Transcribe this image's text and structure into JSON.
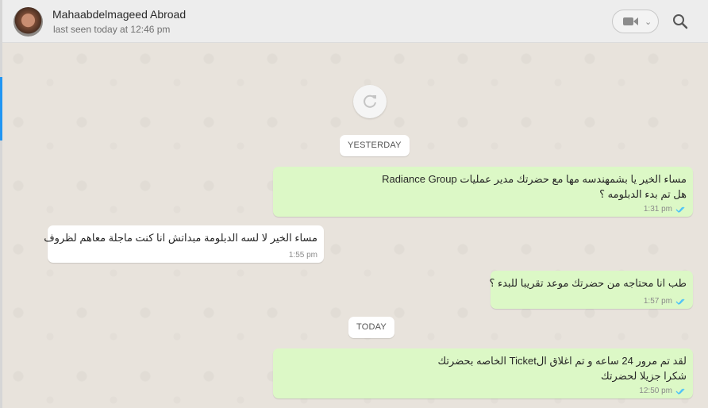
{
  "contact": {
    "name": "Mahaabdelmageed Abroad",
    "status": "last seen today at 12:46 pm"
  },
  "icons": {
    "video": "video-camera-icon",
    "dropdown": "chevron-down-icon",
    "search": "search-icon",
    "reload": "refresh-icon",
    "read": "double-check-icon"
  },
  "colors": {
    "outgoing_bubble": "#dcf8c6",
    "incoming_bubble": "#ffffff",
    "read_ticks": "#4fc3f7"
  },
  "messages": {
    "date_yesterday": "YESTERDAY",
    "date_today": "TODAY",
    "m1": {
      "line1": "مساء الخير يا بشمهندسه مها مع حضرتك  مدير عمليات Radiance Group",
      "line2": "هل تم بدء الدبلومه ؟",
      "time": "1:31 pm"
    },
    "m2": {
      "line1": "مساء الخير لا لسه الدبلومة مبداتش انا كنت ماجلة معاهم لظروف",
      "time": "1:55 pm"
    },
    "m3": {
      "line1": "طب انا محتاجه من حضرتك موعد تقريبا للبدء ؟",
      "time": "1:57 pm"
    },
    "m4": {
      "line1": "لقد تم مرور 24 ساعه و تم اغلاق الTicket الخاصه بحضرتك",
      "line2": "شكرا جزيلا لحضرتك",
      "time": "12:50 pm"
    }
  }
}
